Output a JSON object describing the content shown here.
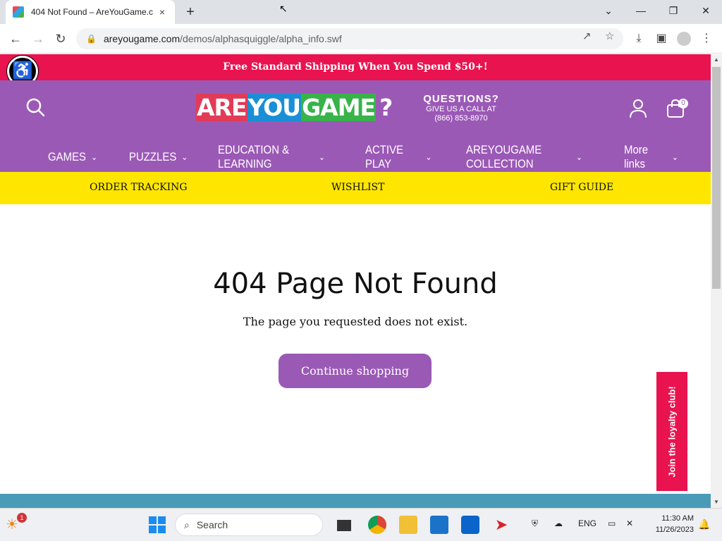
{
  "browser": {
    "tab_title": "404 Not Found – AreYouGame.c",
    "tab_close": "×",
    "new_tab": "+",
    "url_host": "areyougame.com",
    "url_path": "/demos/alphasquiggle/alpha_info.swf"
  },
  "site": {
    "promo": "Free Standard Shipping When You Spend $50+!",
    "logo": {
      "part1": "ARE",
      "part2": "YOU",
      "part3": "GAME",
      "mark": "?"
    },
    "questions": {
      "title": "QUESTIONS?",
      "line1": "GIVE US A CALL AT",
      "phone": "(866) 853-8970"
    },
    "cart_count": "0",
    "nav": [
      {
        "label": "GAMES"
      },
      {
        "label": "PUZZLES"
      },
      {
        "label": "EDUCATION & LEARNING"
      },
      {
        "label": "ACTIVE PLAY"
      },
      {
        "label": "AREYOUGAME COLLECTION"
      },
      {
        "label": "More links"
      }
    ],
    "subnav": {
      "tracking": "ORDER TRACKING",
      "wishlist": "WISHLIST",
      "gift": "GIFT GUIDE"
    },
    "error": {
      "heading": "404 Page Not Found",
      "message": "The page you requested does not exist.",
      "button": "Continue shopping"
    },
    "loyalty": "Join the loyalty club!"
  },
  "taskbar": {
    "search_label": "Search",
    "lang": "ENG",
    "time": "11:30 AM",
    "date": "11/26/2023",
    "badge": "1"
  },
  "colors": {
    "brand_purple": "#9b59b6",
    "promo_red": "#e8134f",
    "subnav_yellow": "#ffe600"
  }
}
